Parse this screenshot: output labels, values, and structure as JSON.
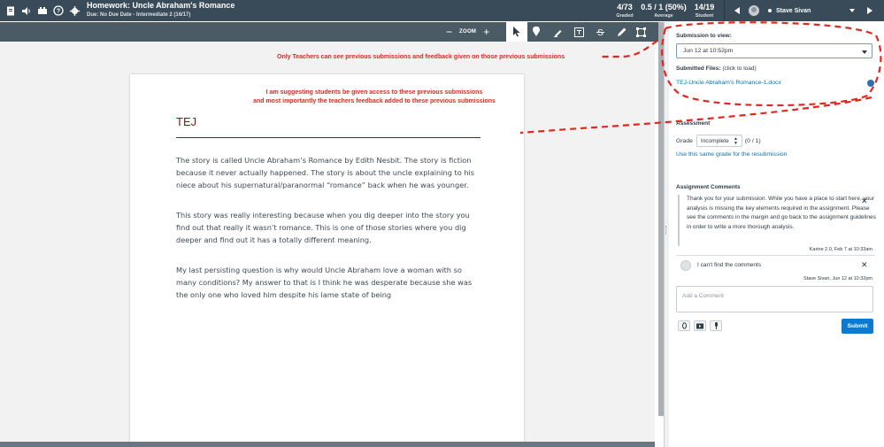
{
  "header": {
    "title": "Homework: Uncle Abraham's Romance",
    "subtitle": "Due: No Due Date - Intermediate 2 (16/17)",
    "stats": [
      {
        "value": "4/73",
        "label": "Graded"
      },
      {
        "value": "0.5 / 1 (50%)",
        "label": "Average"
      },
      {
        "value": "14/19",
        "label": "Student"
      }
    ],
    "student_name": "Stave Sivan",
    "icons": [
      "gradebook-icon",
      "speaker-icon",
      "megaphone-icon",
      "help-icon",
      "settings-icon"
    ]
  },
  "toolbar": {
    "zoom_label": "ZOOM",
    "zoom_out": "−",
    "zoom_in": "+",
    "tools": [
      "pointer-icon",
      "pin-icon",
      "highlight-icon",
      "text-icon",
      "strikeout-icon",
      "draw-icon",
      "area-icon"
    ]
  },
  "annotations": {
    "top_note": "Only Teachers can see previous submissions and feedback given on those previous submissions",
    "doc_note_line1": "I am suggesting students be given access to these previous submissions",
    "doc_note_line2": "and most importantly the teachers feedback added to these previous submissions",
    "color": "#e0281e"
  },
  "document": {
    "heading": "TEJ",
    "paragraphs": [
      "The story is called Uncle Abraham’s Romance by Edith Nesbit. The story is fiction because it never actually happened. The story is about the uncle explaining to his niece about his supernatural/paranormal “romance” back when he was younger.",
      "This story was really interesting because when you dig deeper into the story you find out that really it wasn’t romance. This is one of those stories where you dig deeper and find out it has a totally different meaning.",
      "My last persisting question is why would Uncle Abraham love a woman with so many conditions? My answer to that is I think he was desperate because she was the only one who loved him despite his lame state of being"
    ]
  },
  "panel": {
    "submission_label": "Submission to view:",
    "submission_value": "Jun 12 at 10:52pm",
    "files_label": "Submitted Files:",
    "files_hint": "(click to load)",
    "file_name": "TEJ-Uncle Abraham's Romance-1.docx",
    "assessment_label": "Assessment",
    "grade_label": "Grade",
    "grade_value": "Incomplete",
    "grade_points": "(0 / 1)",
    "same_grade_link": "Use this same grade for the resubmission",
    "comments_label": "Assignment Comments",
    "comments": [
      {
        "text": "Thank you for your submission. While you have a place to start here, your analysis is missing the key elements required in the assignment. Please see the comments in the margin and go back to the assignment guidelines in order to write a more thorough analysis.",
        "meta": "Karine 2.0, Feb 7 at 10:33am"
      },
      {
        "text": "I can't find the comments",
        "meta": "Stave Sivan, Jun 12 at 10:32pm"
      }
    ],
    "add_comment_placeholder": "Add a Comment",
    "submit_label": "Submit",
    "accent": "#0b7ad1"
  }
}
